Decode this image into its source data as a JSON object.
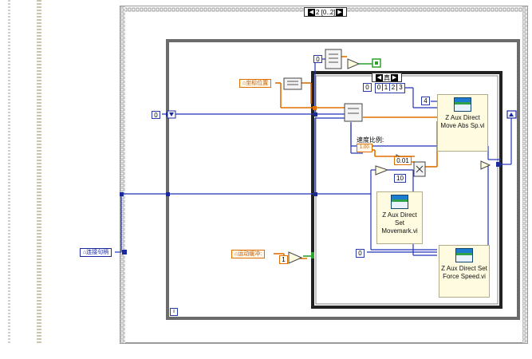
{
  "sequence": {
    "frame_label": "2 [0..2]",
    "prev_icon": "triangle-left-icon",
    "next_icon": "triangle-right-icon"
  },
  "case_structure": {
    "selector_label": "真"
  },
  "loop": {
    "iteration_terminal": "i"
  },
  "labels": {
    "coord_position": "坐标位置",
    "connection_handle": "连接句柄",
    "speed_ratio": "速度比例:",
    "speed_ratio_value": "1.00",
    "motion_buffer": "运动缓冲:"
  },
  "constants": {
    "index_zero": "0",
    "compare_zero": "0",
    "array_index": "0",
    "array_values": [
      "0",
      "1",
      "2",
      "3"
    ],
    "count_four": "4",
    "decimal_value": "0.01",
    "ten": "10",
    "zero_bottom": "0",
    "one": "1"
  },
  "subvis": [
    {
      "title": "Z Aux Direct Move Abs Sp.vi"
    },
    {
      "title": "Z Aux Direct Set Movemark.vi"
    },
    {
      "title": "Z Aux Direct Set Force Speed.vi"
    }
  ],
  "colors": {
    "wire_blue": "#2233bb",
    "wire_orange": "#e07000",
    "wire_green": "#2fa02f",
    "vi_background": "#fffbe0"
  }
}
